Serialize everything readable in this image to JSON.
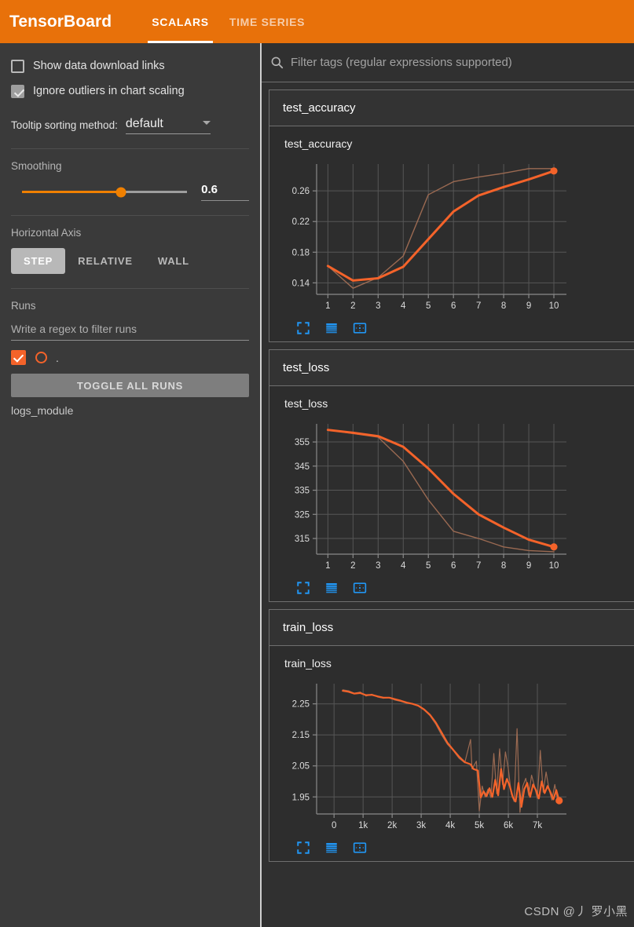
{
  "app": {
    "brand": "TensorBoard",
    "accent_orange": "#e8710a",
    "run_color": "#f4632a",
    "tool_blue": "#2196f3",
    "background": "#3a3a3a",
    "card_background": "#2d2d2d"
  },
  "tabs": [
    {
      "label": "SCALARS",
      "active": true
    },
    {
      "label": "TIME SERIES",
      "active": false
    }
  ],
  "sidebar": {
    "checkboxes": [
      {
        "label": "Show data download links",
        "checked": false
      },
      {
        "label": "Ignore outliers in chart scaling",
        "checked": true
      }
    ],
    "tooltip": {
      "label": "Tooltip sorting method:",
      "value": "default",
      "icon": "chevron-down-icon"
    },
    "smoothing": {
      "label": "Smoothing",
      "value": "0.6",
      "percent": 60
    },
    "horizontal_axis": {
      "label": "Horizontal Axis",
      "options": [
        "STEP",
        "RELATIVE",
        "WALL"
      ],
      "selected": "STEP"
    },
    "runs": {
      "label": "Runs",
      "filter_placeholder": "Write a regex to filter runs",
      "run_entry_label": ".",
      "toggle_all_label": "TOGGLE ALL RUNS",
      "log_dir": "logs_module"
    }
  },
  "filter": {
    "icon": "search-icon",
    "placeholder": "Filter tags (regular expressions supported)"
  },
  "chart_tools": [
    {
      "name": "expand-corners-icon",
      "title": "fit domain to data"
    },
    {
      "name": "data-table-icon",
      "title": "toggle y-axis log scale"
    },
    {
      "name": "resize-frame-icon",
      "title": "toggle fullscreen"
    }
  ],
  "watermark": "CSDN @丿 罗小黑",
  "cards": [
    {
      "header": "test_accuracy",
      "chart_index": 0
    },
    {
      "header": "test_loss",
      "chart_index": 1
    },
    {
      "header": "train_loss",
      "chart_index": 2
    }
  ],
  "chart_data": [
    {
      "type": "line",
      "title": "test_accuracy",
      "xlabel": "",
      "ylabel": "",
      "grid": true,
      "legend": "none",
      "xlim": [
        0.55,
        10.5
      ],
      "ylim": [
        0.125,
        0.295
      ],
      "xticks": [
        1,
        2,
        3,
        4,
        5,
        6,
        7,
        8,
        9,
        10
      ],
      "xticklabels": [
        "1",
        "2",
        "3",
        "4",
        "5",
        "6",
        "7",
        "8",
        "9",
        "10"
      ],
      "yticks": [
        0.14,
        0.18,
        0.22,
        0.26
      ],
      "yticklabels": [
        "0.14",
        "0.18",
        "0.22",
        "0.26"
      ],
      "series": [
        {
          "name": "logs_module (raw)",
          "color": "#9b6a52",
          "width": 1.4,
          "x": [
            1,
            2,
            3,
            4,
            5,
            6,
            7,
            8,
            9,
            10
          ],
          "values": [
            0.162,
            0.133,
            0.147,
            0.175,
            0.255,
            0.272,
            0.278,
            0.283,
            0.289,
            0.289
          ]
        },
        {
          "name": "logs_module (smoothed)",
          "color": "#f4632a",
          "width": 3.0,
          "marker_last": true,
          "x": [
            1,
            2,
            3,
            4,
            5,
            6,
            7,
            8,
            9,
            10
          ],
          "values": [
            0.162,
            0.143,
            0.146,
            0.161,
            0.197,
            0.233,
            0.254,
            0.265,
            0.275,
            0.286
          ]
        }
      ]
    },
    {
      "type": "line",
      "title": "test_loss",
      "xlabel": "",
      "ylabel": "",
      "grid": true,
      "legend": "none",
      "xlim": [
        0.55,
        10.5
      ],
      "ylim": [
        308.5,
        362.5
      ],
      "xticks": [
        1,
        2,
        3,
        4,
        5,
        6,
        7,
        8,
        9,
        10
      ],
      "xticklabels": [
        "1",
        "2",
        "3",
        "4",
        "5",
        "6",
        "7",
        "8",
        "9",
        "10"
      ],
      "yticks": [
        315,
        325,
        335,
        345,
        355
      ],
      "yticklabels": [
        "315",
        "325",
        "335",
        "345",
        "355"
      ],
      "series": [
        {
          "name": "logs_module (raw)",
          "color": "#9b6a52",
          "width": 1.4,
          "x": [
            1,
            2,
            3,
            4,
            5,
            6,
            7,
            8,
            9,
            10
          ],
          "values": [
            360.0,
            358.5,
            357.0,
            347.0,
            331.0,
            318.0,
            315.0,
            311.5,
            310.0,
            309.5
          ]
        },
        {
          "name": "logs_module (smoothed)",
          "color": "#f4632a",
          "width": 3.0,
          "marker_last": true,
          "x": [
            1,
            2,
            3,
            4,
            5,
            6,
            7,
            8,
            9,
            10
          ],
          "values": [
            360.0,
            358.8,
            357.4,
            353.0,
            344.0,
            333.5,
            325.0,
            319.5,
            314.5,
            311.5
          ]
        }
      ]
    },
    {
      "type": "line",
      "title": "train_loss",
      "xlabel": "",
      "ylabel": "",
      "grid": true,
      "legend": "none",
      "xlim": [
        -600,
        8000
      ],
      "ylim": [
        1.895,
        2.315
      ],
      "xticks": [
        0,
        1000,
        2000,
        3000,
        4000,
        5000,
        6000,
        7000
      ],
      "xticklabels": [
        "0",
        "1k",
        "2k",
        "3k",
        "4k",
        "5k",
        "6k",
        "7k"
      ],
      "yticks": [
        1.95,
        2.05,
        2.15,
        2.25
      ],
      "yticklabels": [
        "1.95",
        "2.05",
        "2.15",
        "2.25"
      ],
      "series": [
        {
          "name": "logs_module (raw)",
          "color": "#9b6a52",
          "width": 1.2,
          "x": [
            300,
            500,
            700,
            900,
            1100,
            1300,
            1500,
            1700,
            1900,
            2100,
            2300,
            2500,
            2700,
            2900,
            3100,
            3300,
            3500,
            3700,
            3900,
            4100,
            4300,
            4500,
            4700,
            4750,
            4900,
            5000,
            5100,
            5200,
            5300,
            5400,
            5500,
            5600,
            5700,
            5800,
            5900,
            6000,
            6100,
            6200,
            6300,
            6400,
            6500,
            6600,
            6700,
            6800,
            6900,
            7000,
            7100,
            7200,
            7300,
            7400,
            7500,
            7600,
            7700
          ],
          "values": [
            2.295,
            2.292,
            2.284,
            2.288,
            2.275,
            2.281,
            2.272,
            2.268,
            2.27,
            2.262,
            2.258,
            2.252,
            2.25,
            2.243,
            2.23,
            2.212,
            2.185,
            2.15,
            2.12,
            2.1,
            2.075,
            2.06,
            2.135,
            2.04,
            2.065,
            1.905,
            1.985,
            1.95,
            1.975,
            1.948,
            2.09,
            1.96,
            2.105,
            1.99,
            2.095,
            2.04,
            1.96,
            1.935,
            2.17,
            1.9,
            1.985,
            2.01,
            1.955,
            2.02,
            1.985,
            1.945,
            2.1,
            1.965,
            2.03,
            1.975,
            1.94,
            1.99,
            1.935
          ]
        },
        {
          "name": "logs_module (smoothed)",
          "color": "#f4632a",
          "width": 2.2,
          "marker_last": true,
          "x": [
            300,
            500,
            700,
            900,
            1100,
            1300,
            1500,
            1700,
            1900,
            2100,
            2300,
            2500,
            2700,
            2900,
            3100,
            3300,
            3500,
            3700,
            3900,
            4100,
            4300,
            4500,
            4700,
            4800,
            4950,
            5050,
            5150,
            5250,
            5350,
            5450,
            5550,
            5650,
            5750,
            5850,
            5950,
            6050,
            6150,
            6250,
            6350,
            6450,
            6550,
            6650,
            6750,
            6850,
            6950,
            7050,
            7150,
            7250,
            7350,
            7450,
            7550,
            7650,
            7750
          ],
          "values": [
            2.292,
            2.289,
            2.283,
            2.285,
            2.278,
            2.279,
            2.274,
            2.27,
            2.27,
            2.265,
            2.26,
            2.254,
            2.25,
            2.244,
            2.232,
            2.215,
            2.19,
            2.158,
            2.125,
            2.102,
            2.08,
            2.062,
            2.055,
            2.04,
            2.035,
            1.948,
            1.968,
            1.952,
            1.978,
            1.95,
            2.005,
            1.955,
            2.04,
            1.975,
            2.008,
            1.985,
            1.95,
            1.935,
            1.995,
            1.918,
            1.975,
            1.995,
            1.95,
            1.99,
            1.972,
            1.945,
            2.0,
            1.962,
            1.985,
            1.965,
            1.942,
            1.972,
            1.938
          ]
        }
      ]
    }
  ]
}
